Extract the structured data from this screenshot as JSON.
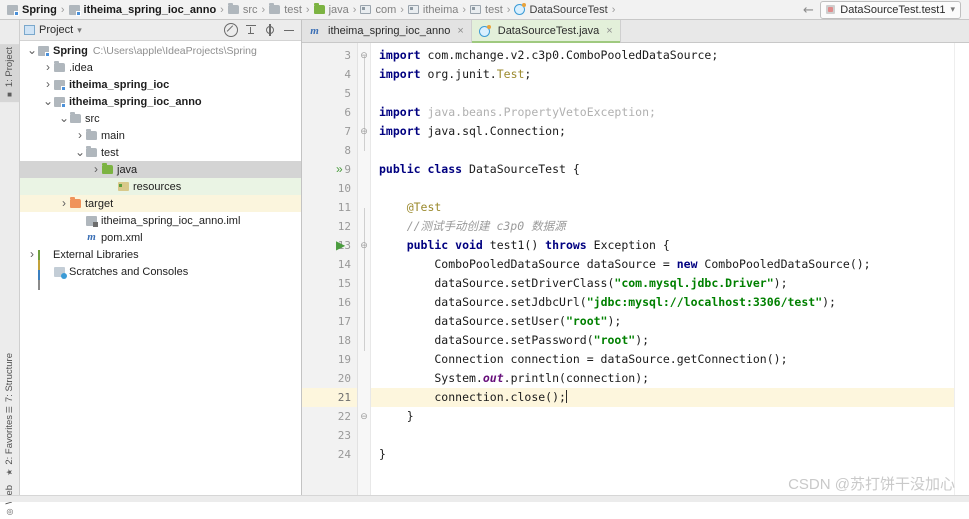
{
  "breadcrumb": {
    "items": [
      {
        "label": "Spring",
        "icon": "module-icon",
        "style": "bold"
      },
      {
        "label": "itheima_spring_ioc_anno",
        "icon": "module-icon",
        "style": "bold"
      },
      {
        "label": "src",
        "icon": "folder-icon",
        "style": "dim"
      },
      {
        "label": "test",
        "icon": "folder-icon",
        "style": "dim"
      },
      {
        "label": "java",
        "icon": "source-folder-icon",
        "style": "dim"
      },
      {
        "label": "com",
        "icon": "package-icon",
        "style": "dim"
      },
      {
        "label": "itheima",
        "icon": "package-icon",
        "style": "dim"
      },
      {
        "label": "test",
        "icon": "package-icon",
        "style": "dim"
      },
      {
        "label": "DataSourceTest",
        "icon": "java-class-icon",
        "style": "normal"
      }
    ]
  },
  "toolbar": {
    "run_configuration": "DataSourceTest.test1",
    "back_arrow_icon": "back-arrow-icon",
    "dropdown_icon": "chevron-down-icon"
  },
  "tool_windows": [
    {
      "label": "1: Project",
      "active": true
    },
    {
      "label": "7: Structure",
      "active": false
    },
    {
      "label": "2: Favorites",
      "active": false
    },
    {
      "label": "Web",
      "active": false
    }
  ],
  "project_panel": {
    "title": "Project",
    "dropdown_icon": "chevron-down-icon",
    "actions": [
      {
        "name": "collapse-all-icon",
        "label": "Collapse All"
      },
      {
        "name": "scroll-from-source-icon",
        "label": "Select Opened File"
      },
      {
        "name": "gear-icon",
        "label": "Settings"
      },
      {
        "name": "minimize-icon",
        "label": "Hide"
      }
    ],
    "tree": [
      {
        "label": "Spring",
        "path": "C:\\Users\\apple\\IdeaProjects\\Spring",
        "indent": 0,
        "arrow": "expanded",
        "icon": "module-icon",
        "bold": true,
        "highlight": "none"
      },
      {
        "label": ".idea",
        "path": "",
        "indent": 1,
        "arrow": "collapsed",
        "icon": "folder-icon",
        "bold": false,
        "highlight": "none"
      },
      {
        "label": "itheima_spring_ioc",
        "path": "",
        "indent": 1,
        "arrow": "collapsed",
        "icon": "module-icon",
        "bold": true,
        "highlight": "none"
      },
      {
        "label": "itheima_spring_ioc_anno",
        "path": "",
        "indent": 1,
        "arrow": "expanded",
        "icon": "module-icon",
        "bold": true,
        "highlight": "none"
      },
      {
        "label": "src",
        "path": "",
        "indent": 2,
        "arrow": "expanded",
        "icon": "folder-icon",
        "bold": false,
        "highlight": "none"
      },
      {
        "label": "main",
        "path": "",
        "indent": 3,
        "arrow": "collapsed",
        "icon": "folder-icon",
        "bold": false,
        "highlight": "none"
      },
      {
        "label": "test",
        "path": "",
        "indent": 3,
        "arrow": "expanded",
        "icon": "folder-icon",
        "bold": false,
        "highlight": "none"
      },
      {
        "label": "java",
        "path": "",
        "indent": 4,
        "arrow": "collapsed",
        "icon": "source-folder-icon",
        "bold": false,
        "highlight": "gray"
      },
      {
        "label": "resources",
        "path": "",
        "indent": 5,
        "arrow": "none",
        "icon": "resources-folder-icon",
        "bold": false,
        "highlight": "green"
      },
      {
        "label": "target",
        "path": "",
        "indent": 2,
        "arrow": "collapsed",
        "icon": "target-folder-icon",
        "bold": false,
        "highlight": "yellow"
      },
      {
        "label": "itheima_spring_ioc_anno.iml",
        "path": "",
        "indent": 3,
        "arrow": "none",
        "icon": "iml-file-icon",
        "bold": false,
        "highlight": "none"
      },
      {
        "label": "pom.xml",
        "path": "",
        "indent": 3,
        "arrow": "none",
        "icon": "maven-icon",
        "bold": false,
        "highlight": "none"
      },
      {
        "label": "External Libraries",
        "path": "",
        "indent": 0,
        "arrow": "collapsed",
        "icon": "libraries-icon",
        "bold": false,
        "highlight": "none"
      },
      {
        "label": "Scratches and Consoles",
        "path": "",
        "indent": 1,
        "arrow": "none",
        "icon": "scratches-icon",
        "bold": false,
        "highlight": "none"
      }
    ]
  },
  "editor": {
    "tabs": [
      {
        "label": "itheima_spring_ioc_anno",
        "icon": "maven-icon",
        "active": false,
        "close_icon": "close-icon"
      },
      {
        "label": "DataSourceTest.java",
        "icon": "java-class-icon",
        "active": true,
        "close_icon": "close-icon"
      }
    ],
    "first_line_number": 3,
    "current_line": 21,
    "gutter_run_markers": [
      {
        "line": 9,
        "glyph": "»",
        "name": "run-class-icon"
      },
      {
        "line": 13,
        "glyph": "▶",
        "name": "run-method-icon"
      }
    ],
    "lines": [
      {
        "n": 3,
        "tokens": [
          {
            "t": "import ",
            "c": "kw"
          },
          {
            "t": "com.mchange.v2.c3p0.ComboPooledDataSource;",
            "c": "plain"
          }
        ]
      },
      {
        "n": 4,
        "tokens": [
          {
            "t": "import ",
            "c": "kw"
          },
          {
            "t": "org.junit.",
            "c": "plain"
          },
          {
            "t": "Test",
            "c": "ann"
          },
          {
            "t": ";",
            "c": "plain"
          }
        ]
      },
      {
        "n": 5,
        "tokens": []
      },
      {
        "n": 6,
        "tokens": [
          {
            "t": "import ",
            "c": "kw"
          },
          {
            "t": "java.beans.PropertyVetoException;",
            "c": "gray"
          }
        ]
      },
      {
        "n": 7,
        "tokens": [
          {
            "t": "import ",
            "c": "kw"
          },
          {
            "t": "java.sql.Connection;",
            "c": "plain"
          }
        ]
      },
      {
        "n": 8,
        "tokens": []
      },
      {
        "n": 9,
        "tokens": [
          {
            "t": "public class ",
            "c": "kw"
          },
          {
            "t": "DataSourceTest {",
            "c": "plain"
          }
        ]
      },
      {
        "n": 10,
        "tokens": []
      },
      {
        "n": 11,
        "tokens": [
          {
            "t": "    @Test",
            "c": "ann"
          }
        ]
      },
      {
        "n": 12,
        "tokens": [
          {
            "t": "    //测试手动创建 c3p0 数据源",
            "c": "cmt"
          }
        ]
      },
      {
        "n": 13,
        "tokens": [
          {
            "t": "    public void ",
            "c": "kw"
          },
          {
            "t": "test1() ",
            "c": "plain"
          },
          {
            "t": "throws ",
            "c": "kw"
          },
          {
            "t": "Exception {",
            "c": "plain"
          }
        ]
      },
      {
        "n": 14,
        "tokens": [
          {
            "t": "        ComboPooledDataSource dataSource = ",
            "c": "plain"
          },
          {
            "t": "new ",
            "c": "kw"
          },
          {
            "t": "ComboPooledDataSource();",
            "c": "plain"
          }
        ]
      },
      {
        "n": 15,
        "tokens": [
          {
            "t": "        dataSource.setDriverClass(",
            "c": "plain"
          },
          {
            "t": "\"com.mysql.jdbc.Driver\"",
            "c": "str"
          },
          {
            "t": ");",
            "c": "plain"
          }
        ]
      },
      {
        "n": 16,
        "tokens": [
          {
            "t": "        dataSource.setJdbcUrl(",
            "c": "plain"
          },
          {
            "t": "\"jdbc:mysql://localhost:3306/test\"",
            "c": "str"
          },
          {
            "t": ");",
            "c": "plain"
          }
        ]
      },
      {
        "n": 17,
        "tokens": [
          {
            "t": "        dataSource.setUser(",
            "c": "plain"
          },
          {
            "t": "\"root\"",
            "c": "str"
          },
          {
            "t": ");",
            "c": "plain"
          }
        ]
      },
      {
        "n": 18,
        "tokens": [
          {
            "t": "        dataSource.setPassword(",
            "c": "plain"
          },
          {
            "t": "\"root\"",
            "c": "str"
          },
          {
            "t": ");",
            "c": "plain"
          }
        ]
      },
      {
        "n": 19,
        "tokens": [
          {
            "t": "        Connection connection = dataSource.getConnection();",
            "c": "plain"
          }
        ]
      },
      {
        "n": 20,
        "tokens": [
          {
            "t": "        System.",
            "c": "plain"
          },
          {
            "t": "out",
            "c": "fld"
          },
          {
            "t": ".println(connection);",
            "c": "plain"
          }
        ]
      },
      {
        "n": 21,
        "tokens": [
          {
            "t": "        connection.close();",
            "c": "plain"
          }
        ],
        "caret": true
      },
      {
        "n": 22,
        "tokens": [
          {
            "t": "    }",
            "c": "plain"
          }
        ]
      },
      {
        "n": 23,
        "tokens": []
      },
      {
        "n": 24,
        "tokens": [
          {
            "t": "}",
            "c": "plain"
          }
        ]
      }
    ]
  },
  "watermark": "CSDN @苏打饼干没加心",
  "colors": {
    "keyword": "#000080",
    "string": "#008000",
    "annotation": "#9b8a2e",
    "comment": "#9a9a9a",
    "field": "#660e7a",
    "current_line_bg": "#fdf6dd",
    "active_tab_bg": "#e3f0da",
    "selection_bg": "#d4d4d4"
  }
}
